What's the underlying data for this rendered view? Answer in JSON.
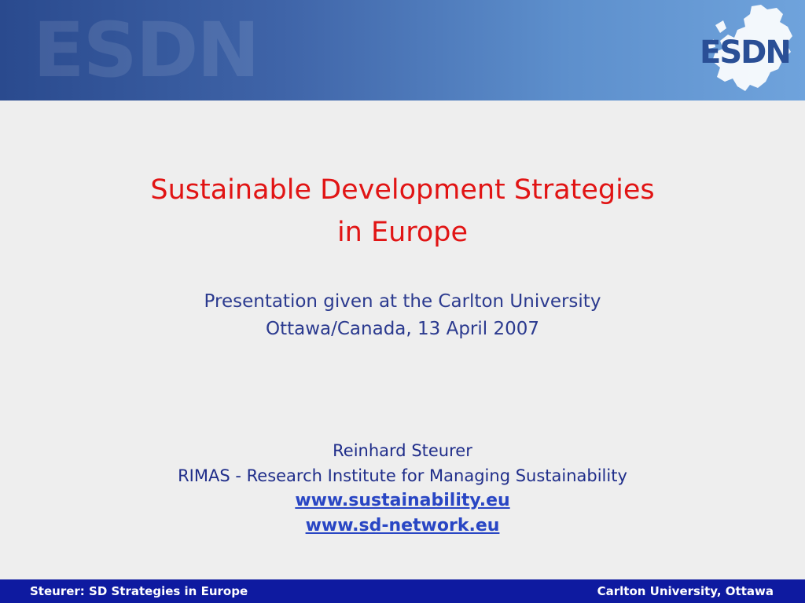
{
  "header": {
    "watermark_text": "ESDN",
    "logo_text": "ESDN"
  },
  "title": {
    "line1": "Sustainable Development Strategies",
    "line2": "in Europe"
  },
  "subtitle": {
    "line1": "Presentation given at the Carlton University",
    "line2": "Ottawa/Canada, 13 April 2007"
  },
  "author": {
    "name": "Reinhard Steurer",
    "institute": "RIMAS - Research Institute for Managing Sustainability",
    "links": [
      "www.sustainability.eu",
      "www.sd-network.eu"
    ]
  },
  "footer": {
    "left": "Steurer: SD Strategies in Europe",
    "right": "Carlton University, Ottawa"
  },
  "colors": {
    "title": "#e11414",
    "text": "#2b3a8f",
    "link": "#2946c4",
    "footer_bg": "#0e1aa0"
  }
}
